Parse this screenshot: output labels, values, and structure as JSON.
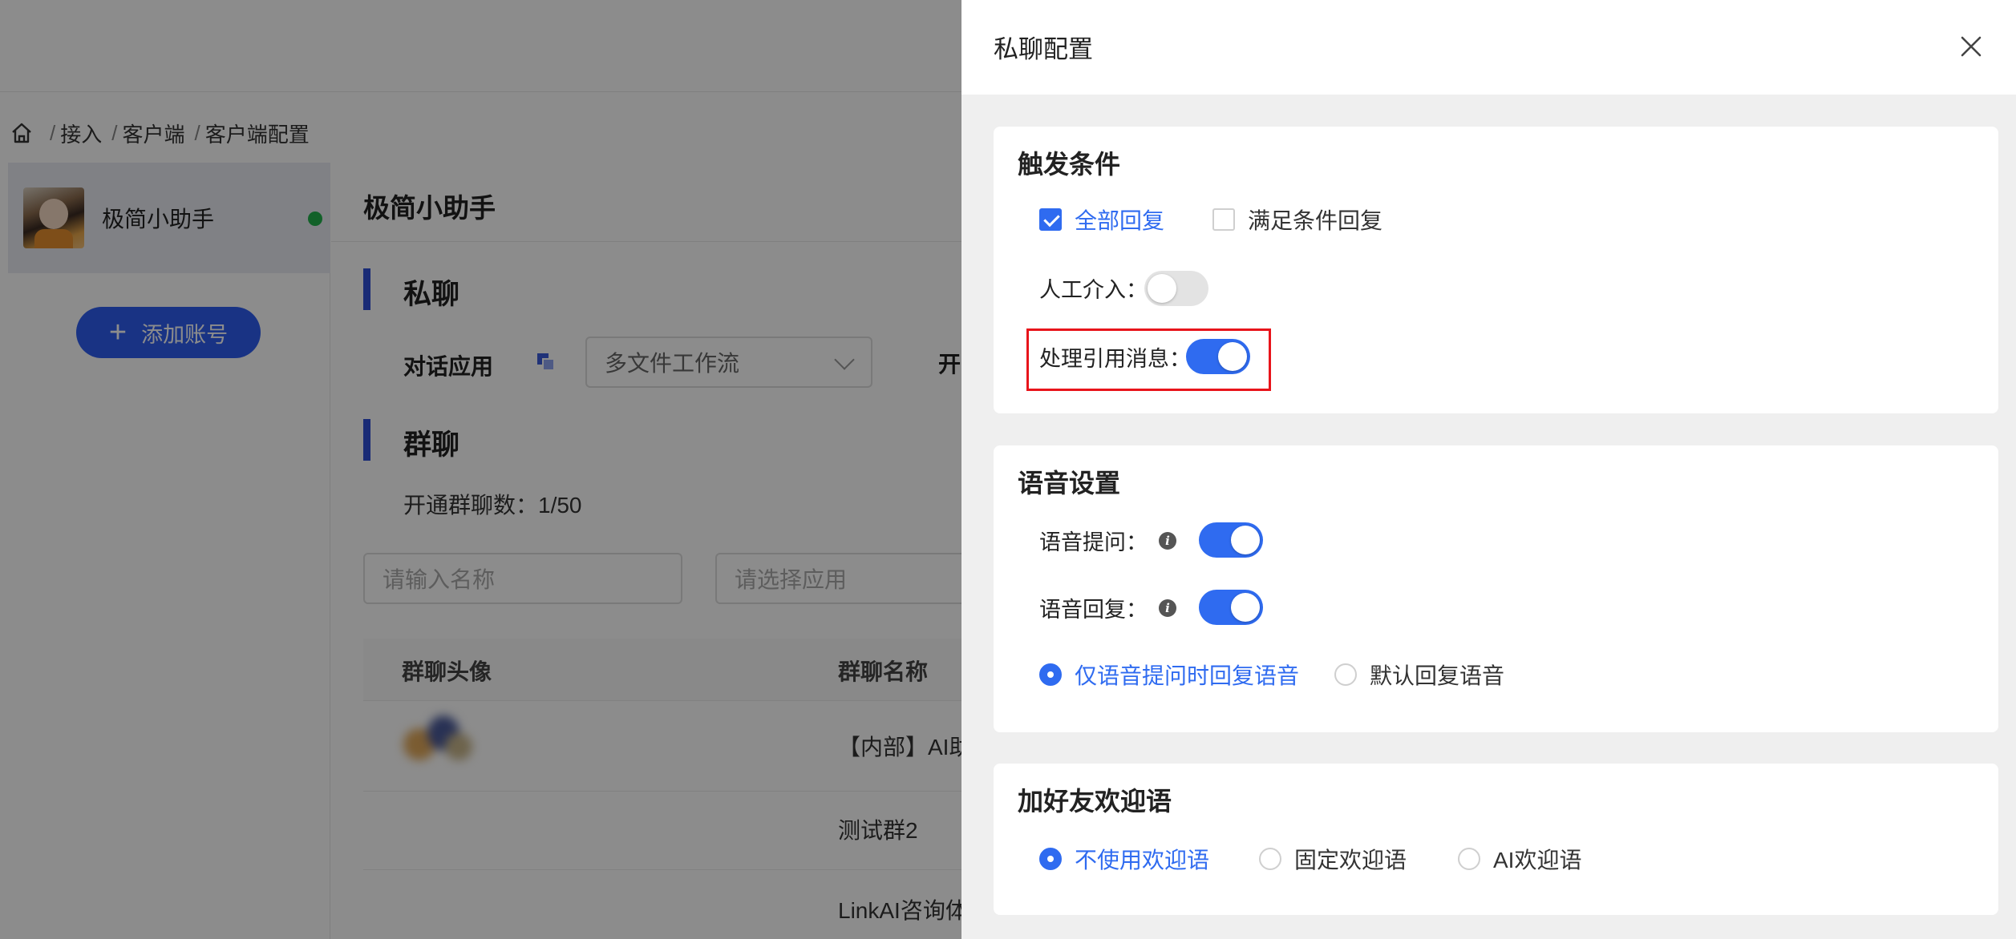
{
  "breadcrumb": {
    "items": [
      "接入",
      "客户端",
      "客户端配置"
    ],
    "separator": "/"
  },
  "account": {
    "name": "极简小助手",
    "status_color": "#22b14c"
  },
  "add_account_label": "添加账号",
  "main": {
    "title": "极简小助手",
    "private_section": "私聊",
    "dialog_app_label": "对话应用",
    "dialog_app_value": "多文件工作流",
    "cut_label": "开",
    "group_section": "群聊",
    "group_count_text": "开通群聊数：1/50",
    "search_name_placeholder": "请输入名称",
    "select_app_placeholder": "请选择应用",
    "table": {
      "headers": [
        "群聊头像",
        "群聊名称"
      ],
      "rows": [
        {
          "name": "【内部】AI助"
        },
        {
          "name": "测试群2"
        },
        {
          "name": "LinkAI咨询体"
        }
      ]
    }
  },
  "drawer": {
    "title": "私聊配置",
    "trigger": {
      "title": "触发条件",
      "options": [
        "全部回复",
        "满足条件回复"
      ],
      "selected": "全部回复",
      "manual_label": "人工介入：",
      "manual_on": false,
      "quote_label": "处理引用消息：",
      "quote_on": true
    },
    "voice": {
      "title": "语音设置",
      "ask_label": "语音提问：",
      "ask_on": true,
      "reply_label": "语音回复：",
      "reply_on": true,
      "options": [
        "仅语音提问时回复语音",
        "默认回复语音"
      ],
      "selected": "仅语音提问时回复语音"
    },
    "welcome": {
      "title": "加好友欢迎语",
      "options": [
        "不使用欢迎语",
        "固定欢迎语",
        "AI欢迎语"
      ],
      "selected": "不使用欢迎语"
    }
  },
  "colors": {
    "accent": "#2f6bf0",
    "highlight": "#e8141b",
    "brand_button": "#2f5ef0"
  }
}
